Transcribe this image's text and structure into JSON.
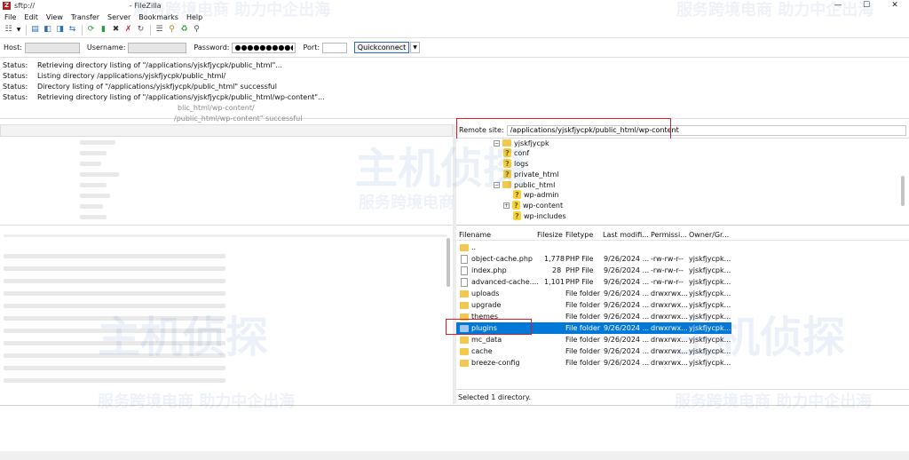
{
  "titlebar": {
    "title": "sftp://              - FileZilla",
    "icon_letter": "Z",
    "minimize": "—",
    "maximize": "☐",
    "close": "✕"
  },
  "menu": [
    "File",
    "Edit",
    "View",
    "Transfer",
    "Server",
    "Bookmarks",
    "Help"
  ],
  "toolbar_icons": [
    "site-manager-icon",
    "dropdown-icon",
    "message-log-icon",
    "local-tree-icon",
    "remote-tree-icon",
    "transfer-queue-icon",
    "refresh-icon",
    "process-queue-icon",
    "cancel-icon",
    "disconnect-icon",
    "reconnect-icon",
    "filter-icon",
    "compare-icon",
    "sync-browse-icon",
    "search-icon"
  ],
  "quickconnect": {
    "host_label": "Host:",
    "user_label": "Username:",
    "pass_label": "Password:",
    "pass_value": "●●●●●●●●●●●●●",
    "port_label": "Port:",
    "button": "Quickconnect",
    "dropdown": "▼"
  },
  "log": [
    {
      "label": "Status:",
      "text": "Retrieving directory listing of \"/applications/yjskfjycpk/public_html\"..."
    },
    {
      "label": "Status:",
      "text": "Listing directory /applications/yjskfjycpk/public_html/"
    },
    {
      "label": "Status:",
      "text": "Directory listing of \"/applications/yjskfjycpk/public_html\" successful"
    },
    {
      "label": "Status:",
      "text": "Retrieving directory listing of \"/applications/yjskfjycpk/public_html/wp-content\"..."
    },
    {
      "label": "",
      "text": "blic_html/wp-content/"
    },
    {
      "label": "",
      "text": "/public_html/wp-content\" successful"
    }
  ],
  "remote": {
    "site_label": "Remote site:",
    "site_path": "/applications/yjskfjycpk/public_html/wp-content",
    "tree": [
      {
        "label": "yjskfjycpk",
        "kind": "folder"
      },
      {
        "label": "conf",
        "kind": "unknown"
      },
      {
        "label": "logs",
        "kind": "unknown"
      },
      {
        "label": "private_html",
        "kind": "unknown"
      },
      {
        "label": "public_html",
        "kind": "folder"
      },
      {
        "label": "wp-admin",
        "kind": "unknown"
      },
      {
        "label": "wp-content",
        "kind": "unknown"
      },
      {
        "label": "wp-includes",
        "kind": "unknown"
      }
    ],
    "columns": [
      "Filename",
      "Filesize",
      "Filetype",
      "Last modifi...",
      "Permissi...",
      "Owner/Gr..."
    ],
    "files": [
      {
        "name": "..",
        "size": "",
        "type": "",
        "date": "",
        "perm": "",
        "owner": "",
        "kind": "up"
      },
      {
        "name": "object-cache.php",
        "size": "1,778",
        "type": "PHP File",
        "date": "9/26/2024 ...",
        "perm": "-rw-rw-r--",
        "owner": "yjskfjycpk...",
        "kind": "file"
      },
      {
        "name": "index.php",
        "size": "28",
        "type": "PHP File",
        "date": "9/26/2024 ...",
        "perm": "-rw-rw-r--",
        "owner": "yjskfjycpk...",
        "kind": "file"
      },
      {
        "name": "advanced-cache....",
        "size": "1,101",
        "type": "PHP File",
        "date": "9/26/2024 ...",
        "perm": "-rw-rw-r--",
        "owner": "yjskfjycpk...",
        "kind": "file"
      },
      {
        "name": "uploads",
        "size": "",
        "type": "File folder",
        "date": "9/26/2024 ...",
        "perm": "drwxrwx...",
        "owner": "yjskfjycpk...",
        "kind": "folder"
      },
      {
        "name": "upgrade",
        "size": "",
        "type": "File folder",
        "date": "9/26/2024 ...",
        "perm": "drwxrwx...",
        "owner": "yjskfjycpk...",
        "kind": "folder"
      },
      {
        "name": "themes",
        "size": "",
        "type": "File folder",
        "date": "9/26/2024 ...",
        "perm": "drwxrwx...",
        "owner": "yjskfjycpk...",
        "kind": "folder"
      },
      {
        "name": "plugins",
        "size": "",
        "type": "File folder",
        "date": "9/26/2024 ...",
        "perm": "drwxrwx...",
        "owner": "yjskfjycpk...",
        "kind": "folder",
        "selected": true
      },
      {
        "name": "mc_data",
        "size": "",
        "type": "File folder",
        "date": "9/26/2024 ...",
        "perm": "drwxrwx...",
        "owner": "yjskfjycpk...",
        "kind": "folder"
      },
      {
        "name": "cache",
        "size": "",
        "type": "File folder",
        "date": "9/26/2024 ...",
        "perm": "drwxrwx...",
        "owner": "yjskfjycpk...",
        "kind": "folder"
      },
      {
        "name": "breeze-config",
        "size": "",
        "type": "File folder",
        "date": "9/26/2024 ...",
        "perm": "drwxrwx...",
        "owner": "yjskfjycpk...",
        "kind": "folder"
      }
    ],
    "status": "Selected 1 directory."
  },
  "watermarks": [
    "服务跨境电商 助力中企出海",
    "服务跨境电商",
    "主机侦探",
    "服务跨境电商 助力中企出海"
  ],
  "colors": {
    "selection": "#0078d7",
    "highlight_box": "#d9202a",
    "folder": "#f2c94c"
  }
}
